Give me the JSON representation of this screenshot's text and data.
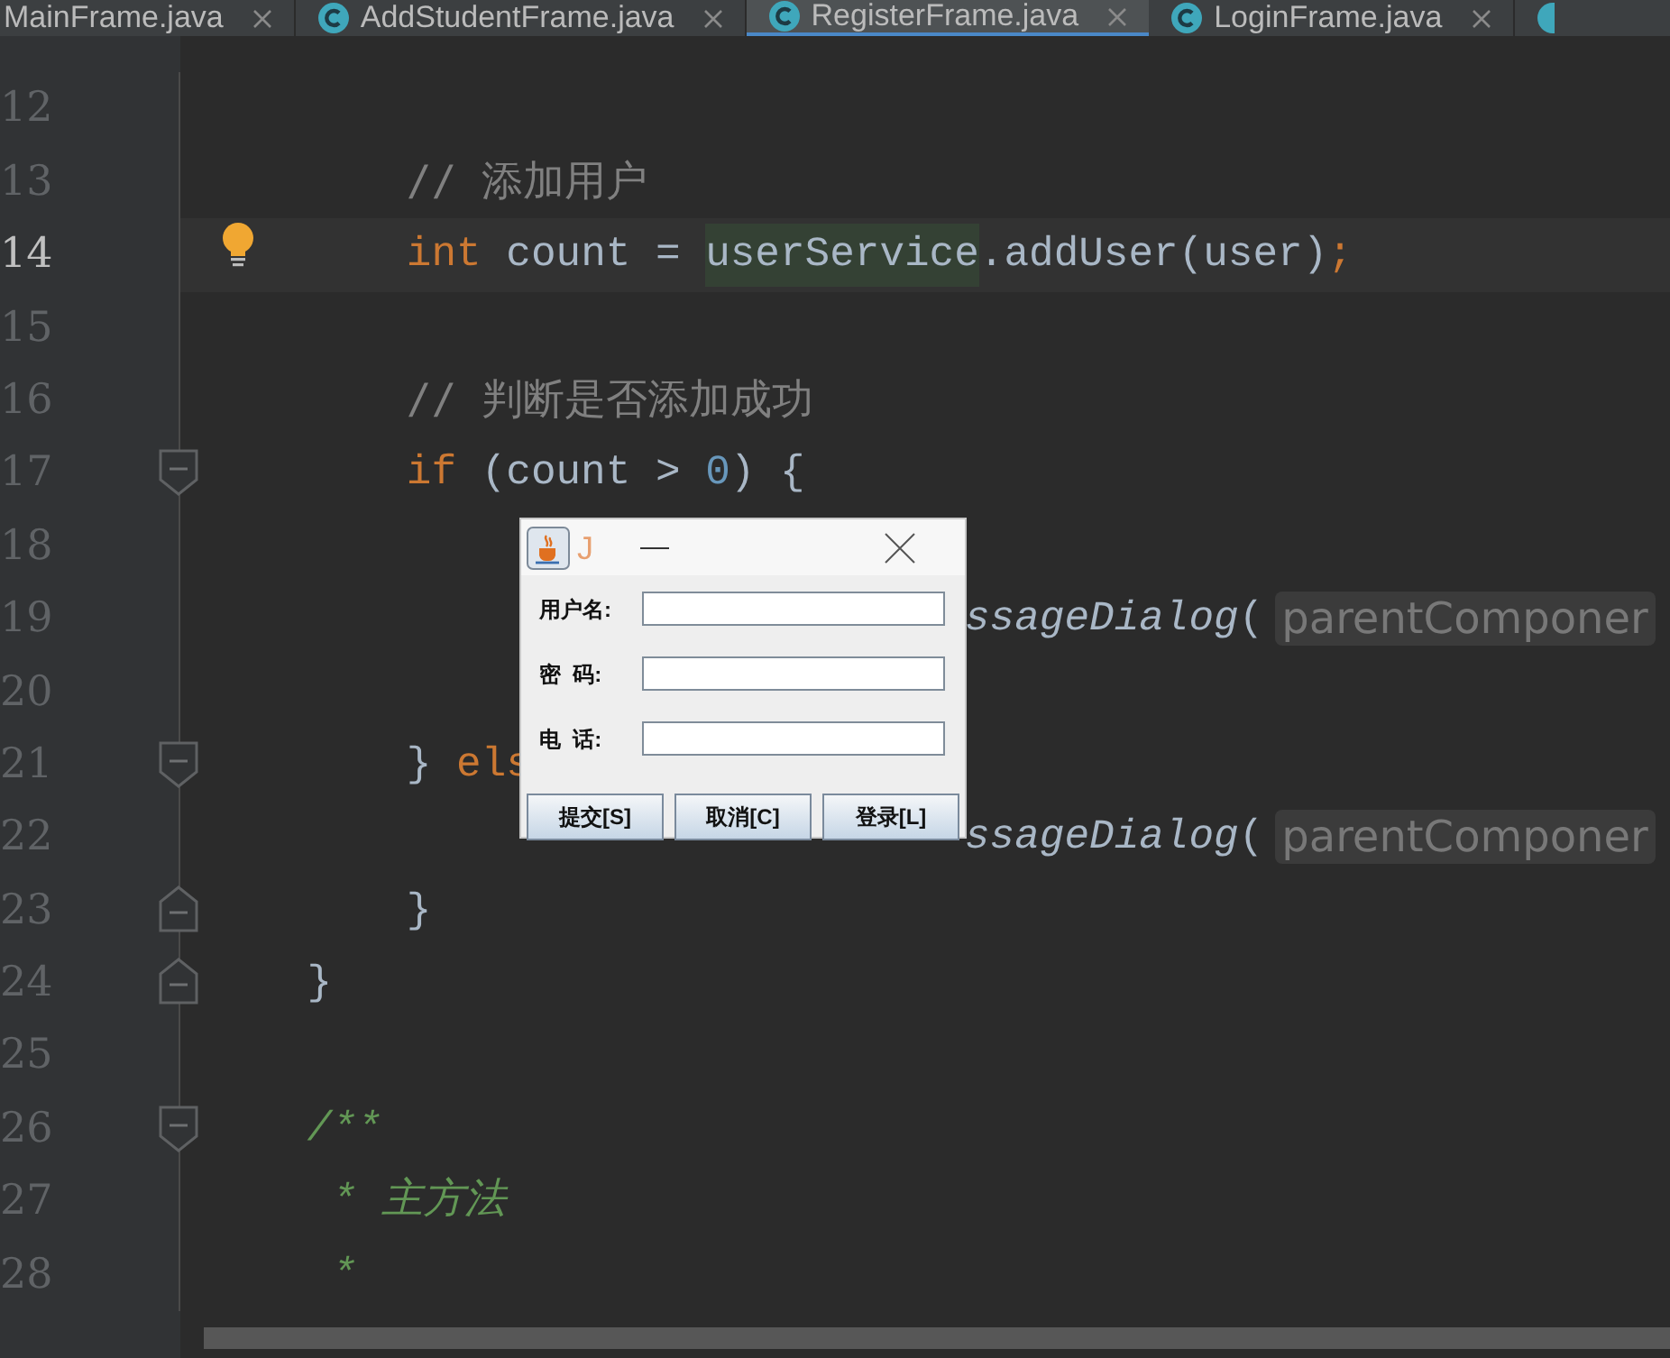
{
  "tabs": [
    {
      "label": "MainFrame.java",
      "selected": false
    },
    {
      "label": "AddStudentFrame.java",
      "selected": false
    },
    {
      "label": "RegisterFrame.java",
      "selected": true
    },
    {
      "label": "LoginFrame.java",
      "selected": false
    }
  ],
  "lines": [
    {
      "number": "12",
      "current": false
    },
    {
      "number": "13",
      "current": false,
      "tokens": [
        {
          "text": "        // 添加用户",
          "kind": "comment"
        }
      ]
    },
    {
      "number": "14",
      "current": true,
      "gutter": {
        "kind": "bulb"
      },
      "tokens": [
        {
          "text": "        int",
          "kind": "keyword"
        },
        {
          "text": " count = ",
          "kind": "plain"
        },
        {
          "text": "userService",
          "kind": "usage"
        },
        {
          "text": ".addUser(user)",
          "kind": "plain"
        },
        {
          "text": ";",
          "kind": "keyword"
        }
      ]
    },
    {
      "number": "15",
      "current": false
    },
    {
      "number": "16",
      "current": false,
      "tokens": [
        {
          "text": "        // 判断是否添加成功",
          "kind": "comment"
        }
      ]
    },
    {
      "number": "17",
      "current": false,
      "gutter": {
        "kind": "fold-start"
      },
      "tokens": [
        {
          "text": "        if",
          "kind": "keyword"
        },
        {
          "text": " (count > ",
          "kind": "plain"
        },
        {
          "text": "0",
          "kind": "number"
        },
        {
          "text": ") {",
          "kind": "plain"
        }
      ]
    },
    {
      "number": "18",
      "current": false
    },
    {
      "number": "19",
      "current": false,
      "right": [
        {
          "text": "ssageDialog",
          "kind": "static"
        },
        {
          "text": "(",
          "kind": "plain"
        },
        {
          "text": "parentComponer",
          "kind": "hint"
        }
      ]
    },
    {
      "number": "20",
      "current": false
    },
    {
      "number": "21",
      "current": false,
      "gutter": {
        "kind": "fold-start"
      },
      "tokens": [
        {
          "text": "        } ",
          "kind": "plain"
        },
        {
          "text": "els",
          "kind": "keyword"
        }
      ]
    },
    {
      "number": "22",
      "current": false,
      "right": [
        {
          "text": "ssageDialog",
          "kind": "static"
        },
        {
          "text": "(",
          "kind": "plain"
        },
        {
          "text": "parentComponer",
          "kind": "hint"
        }
      ]
    },
    {
      "number": "23",
      "current": false,
      "gutter": {
        "kind": "fold-end"
      },
      "tokens": [
        {
          "text": "        }",
          "kind": "plain"
        }
      ]
    },
    {
      "number": "24",
      "current": false,
      "gutter": {
        "kind": "fold-end"
      },
      "tokens": [
        {
          "text": "    }",
          "kind": "plain"
        }
      ]
    },
    {
      "number": "25",
      "current": false
    },
    {
      "number": "26",
      "current": false,
      "gutter": {
        "kind": "fold-start"
      },
      "tokens": [
        {
          "text": "    /**",
          "kind": "doc"
        }
      ]
    },
    {
      "number": "27",
      "current": false,
      "tokens": [
        {
          "text": "     * 主方法",
          "kind": "doc"
        }
      ]
    },
    {
      "number": "28",
      "current": false,
      "tokens": [
        {
          "text": "     *",
          "kind": "doc"
        }
      ]
    }
  ],
  "dialog": {
    "title": "J",
    "fields": [
      {
        "label": "用户名:"
      },
      {
        "label": "密  码:"
      },
      {
        "label": "电  话:"
      }
    ],
    "buttons": [
      "提交[S]",
      "取消[C]",
      "登录[L]"
    ]
  }
}
